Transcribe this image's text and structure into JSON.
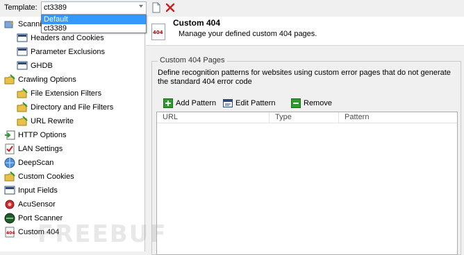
{
  "toolbar": {
    "template_label": "Template:",
    "template_value": "ct3389",
    "template_options": [
      "Default",
      "ct3389"
    ],
    "new_icon": "new-document-icon",
    "delete_icon": "delete-x-icon"
  },
  "tree": {
    "items": [
      {
        "label": "Scanning Options",
        "icon": "scanning-options-icon"
      },
      {
        "label": "Headers and Cookies",
        "icon": "headers-cookies-icon"
      },
      {
        "label": "Parameter Exclusions",
        "icon": "parameter-exclusions-icon"
      },
      {
        "label": "GHDB",
        "icon": "ghdb-icon"
      },
      {
        "label": "Crawling Options",
        "icon": "crawling-options-icon"
      },
      {
        "label": "File Extension Filters",
        "icon": "file-extension-filters-icon"
      },
      {
        "label": "Directory and File Filters",
        "icon": "directory-file-filters-icon"
      },
      {
        "label": "URL Rewrite",
        "icon": "url-rewrite-icon"
      },
      {
        "label": "HTTP Options",
        "icon": "http-options-icon"
      },
      {
        "label": "LAN Settings",
        "icon": "lan-settings-icon"
      },
      {
        "label": "DeepScan",
        "icon": "deepscan-icon"
      },
      {
        "label": "Custom Cookies",
        "icon": "custom-cookies-icon"
      },
      {
        "label": "Input Fields",
        "icon": "input-fields-icon"
      },
      {
        "label": "AcuSensor",
        "icon": "acusensor-icon"
      },
      {
        "label": "Port Scanner",
        "icon": "port-scanner-icon"
      },
      {
        "label": "Custom 404",
        "icon": "custom-404-icon"
      }
    ]
  },
  "main": {
    "title": "Custom 404",
    "subtitle": "Manage your defined custom 404 pages.",
    "page_icon_text": "404",
    "group_title": "Custom 404 Pages",
    "group_desc": "Define recognition patterns for websites using custom error pages that do not generate the standard 404 error code",
    "actions": {
      "add": "Add Pattern",
      "edit": "Edit Pattern",
      "remove": "Remove"
    },
    "columns": [
      "URL",
      "Type",
      "Pattern"
    ]
  },
  "watermark": "FREEBUF",
  "colors": {
    "selection": "#3399ff",
    "delete_red": "#cc1f1f",
    "add_green": "#2e9b2e"
  }
}
